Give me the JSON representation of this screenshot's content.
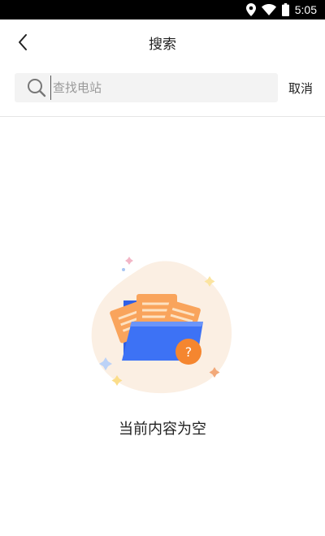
{
  "status_bar": {
    "time": "5:05"
  },
  "header": {
    "title": "搜索"
  },
  "search": {
    "placeholder": "查找电站",
    "value": "",
    "cancel_label": "取消"
  },
  "empty_state": {
    "message": "当前内容为空",
    "badge": "?"
  },
  "colors": {
    "accent_blue": "#3f6ff0",
    "accent_orange": "#f5862f"
  }
}
